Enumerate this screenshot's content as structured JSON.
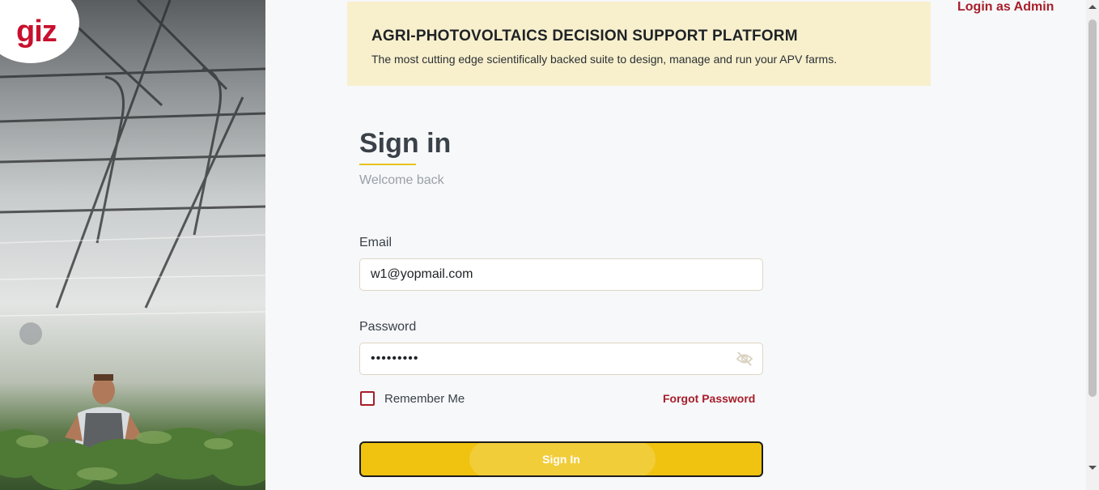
{
  "logo": {
    "text": "giz",
    "color": "#c8102e"
  },
  "banner": {
    "title": "AGRI-PHOTOVOLTAICS DECISION SUPPORT PLATFORM",
    "subtitle": "The most cutting edge scientifically backed suite to design, manage and run your APV farms.",
    "background": "#f8f0cd"
  },
  "header": {
    "admin_link": "Login as Admin"
  },
  "form": {
    "title": "Sign in",
    "welcome": "Welcome back",
    "email_label": "Email",
    "email_value": "w1@yopmail.com",
    "password_label": "Password",
    "password_value": "•••••••••",
    "password_toggle_icon": "eye-off-icon",
    "remember_label": "Remember Me",
    "remember_checked": false,
    "forgot_label": "Forgot Password",
    "submit_label": "Sign In"
  },
  "colors": {
    "accent": "#efc30f",
    "link": "#a61e2a",
    "text": "#3a4148"
  }
}
